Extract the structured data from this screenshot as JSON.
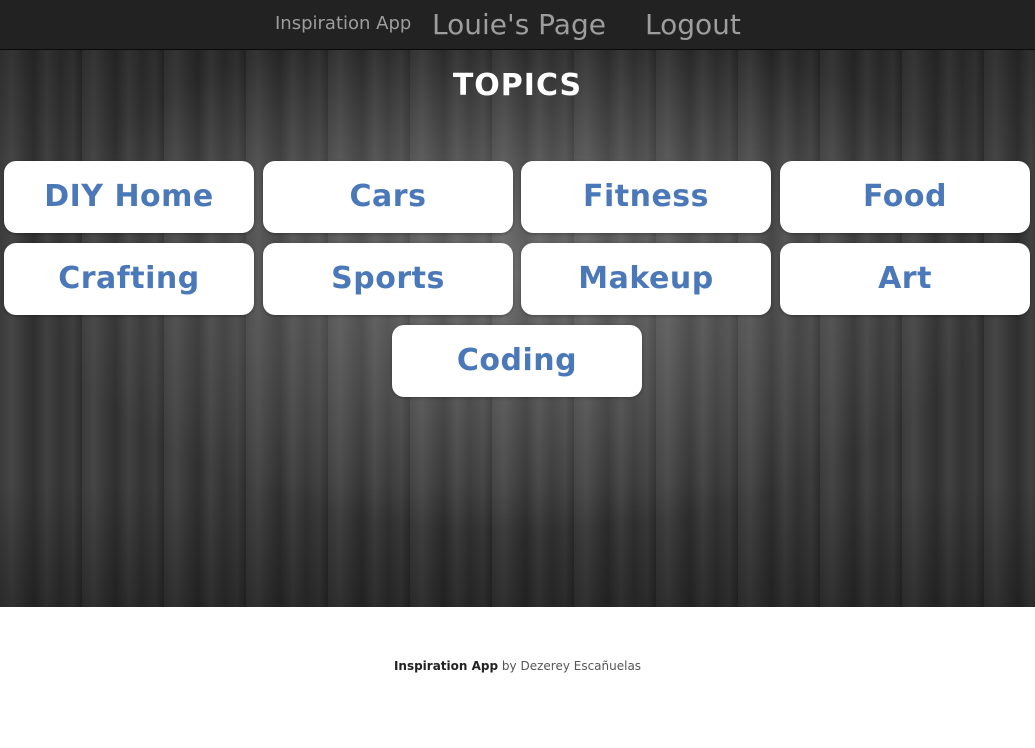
{
  "navbar": {
    "brand": "Inspiration App",
    "links": [
      {
        "label": "Louie's Page"
      },
      {
        "label": "Logout"
      }
    ]
  },
  "hero": {
    "title": "TOPICS"
  },
  "topics": [
    {
      "label": "DIY Home"
    },
    {
      "label": "Cars"
    },
    {
      "label": "Fitness"
    },
    {
      "label": "Food"
    },
    {
      "label": "Crafting"
    },
    {
      "label": "Sports"
    },
    {
      "label": "Makeup"
    },
    {
      "label": "Art"
    },
    {
      "label": "Coding"
    }
  ],
  "footer": {
    "brand": "Inspiration App",
    "by": "by",
    "author": "Dezerey Escañuelas"
  },
  "colors": {
    "navbar_bg": "#222222",
    "nav_text": "#9d9d9d",
    "topic_text": "#4a78b8",
    "topic_bg": "#ffffff"
  }
}
